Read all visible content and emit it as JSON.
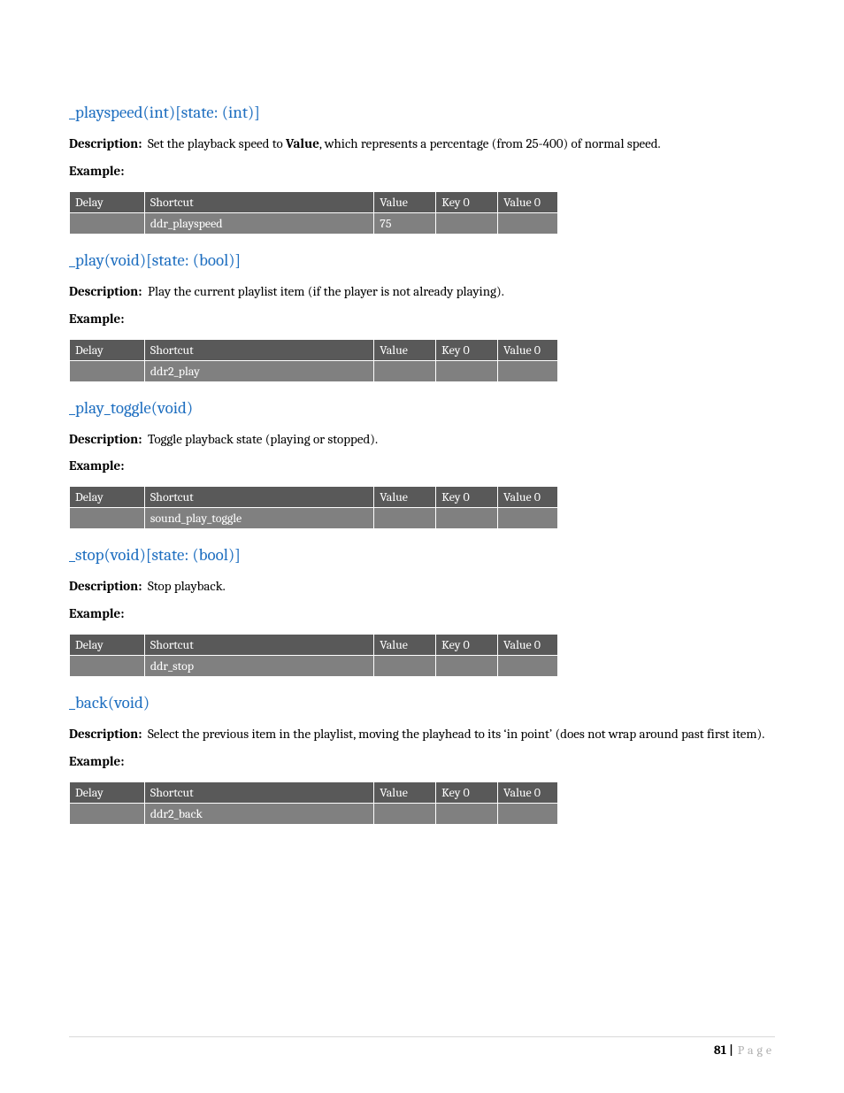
{
  "sections": [
    {
      "heading": "_playspeed(int)[state: (int)]",
      "desc_pre": "Set the playback speed to ",
      "desc_bold": "Value",
      "desc_post": ", which represents a percentage (from 25-400) of normal speed.",
      "row": {
        "delay": "",
        "shortcut": "ddr_playspeed",
        "value": "75",
        "key0": "",
        "value0": ""
      }
    },
    {
      "heading": "_play(void)[state: (bool)]",
      "desc_pre": "Play the current playlist item (if the player is not already playing).",
      "desc_bold": "",
      "desc_post": "",
      "row": {
        "delay": "",
        "shortcut": "ddr2_play",
        "value": "",
        "key0": "",
        "value0": ""
      }
    },
    {
      "heading": "_play_toggle(void)",
      "desc_pre": "Toggle playback state (playing or stopped).",
      "desc_bold": "",
      "desc_post": "",
      "row": {
        "delay": "",
        "shortcut": "sound_play_toggle",
        "value": "",
        "key0": "",
        "value0": ""
      }
    },
    {
      "heading": "_stop(void)[state: (bool)]",
      "desc_pre": "Stop playback.",
      "desc_bold": "",
      "desc_post": "",
      "row": {
        "delay": "",
        "shortcut": "ddr_stop",
        "value": "",
        "key0": "",
        "value0": ""
      }
    },
    {
      "heading": "_back(void)",
      "desc_pre": "Select the previous item in the playlist, moving the playhead to its ‘in point’ (does not wrap around past first item).",
      "desc_bold": "",
      "desc_post": "",
      "row": {
        "delay": "",
        "shortcut": "ddr2_back",
        "value": "",
        "key0": "",
        "value0": ""
      }
    }
  ],
  "labels": {
    "description": "Description:",
    "example": "Example:"
  },
  "table_headers": {
    "delay": "Delay",
    "shortcut": "Shortcut",
    "value": "Value",
    "key0": "Key 0",
    "value0": "Value 0"
  },
  "footer": {
    "page_num": "81 |",
    "page_text": "Page"
  }
}
